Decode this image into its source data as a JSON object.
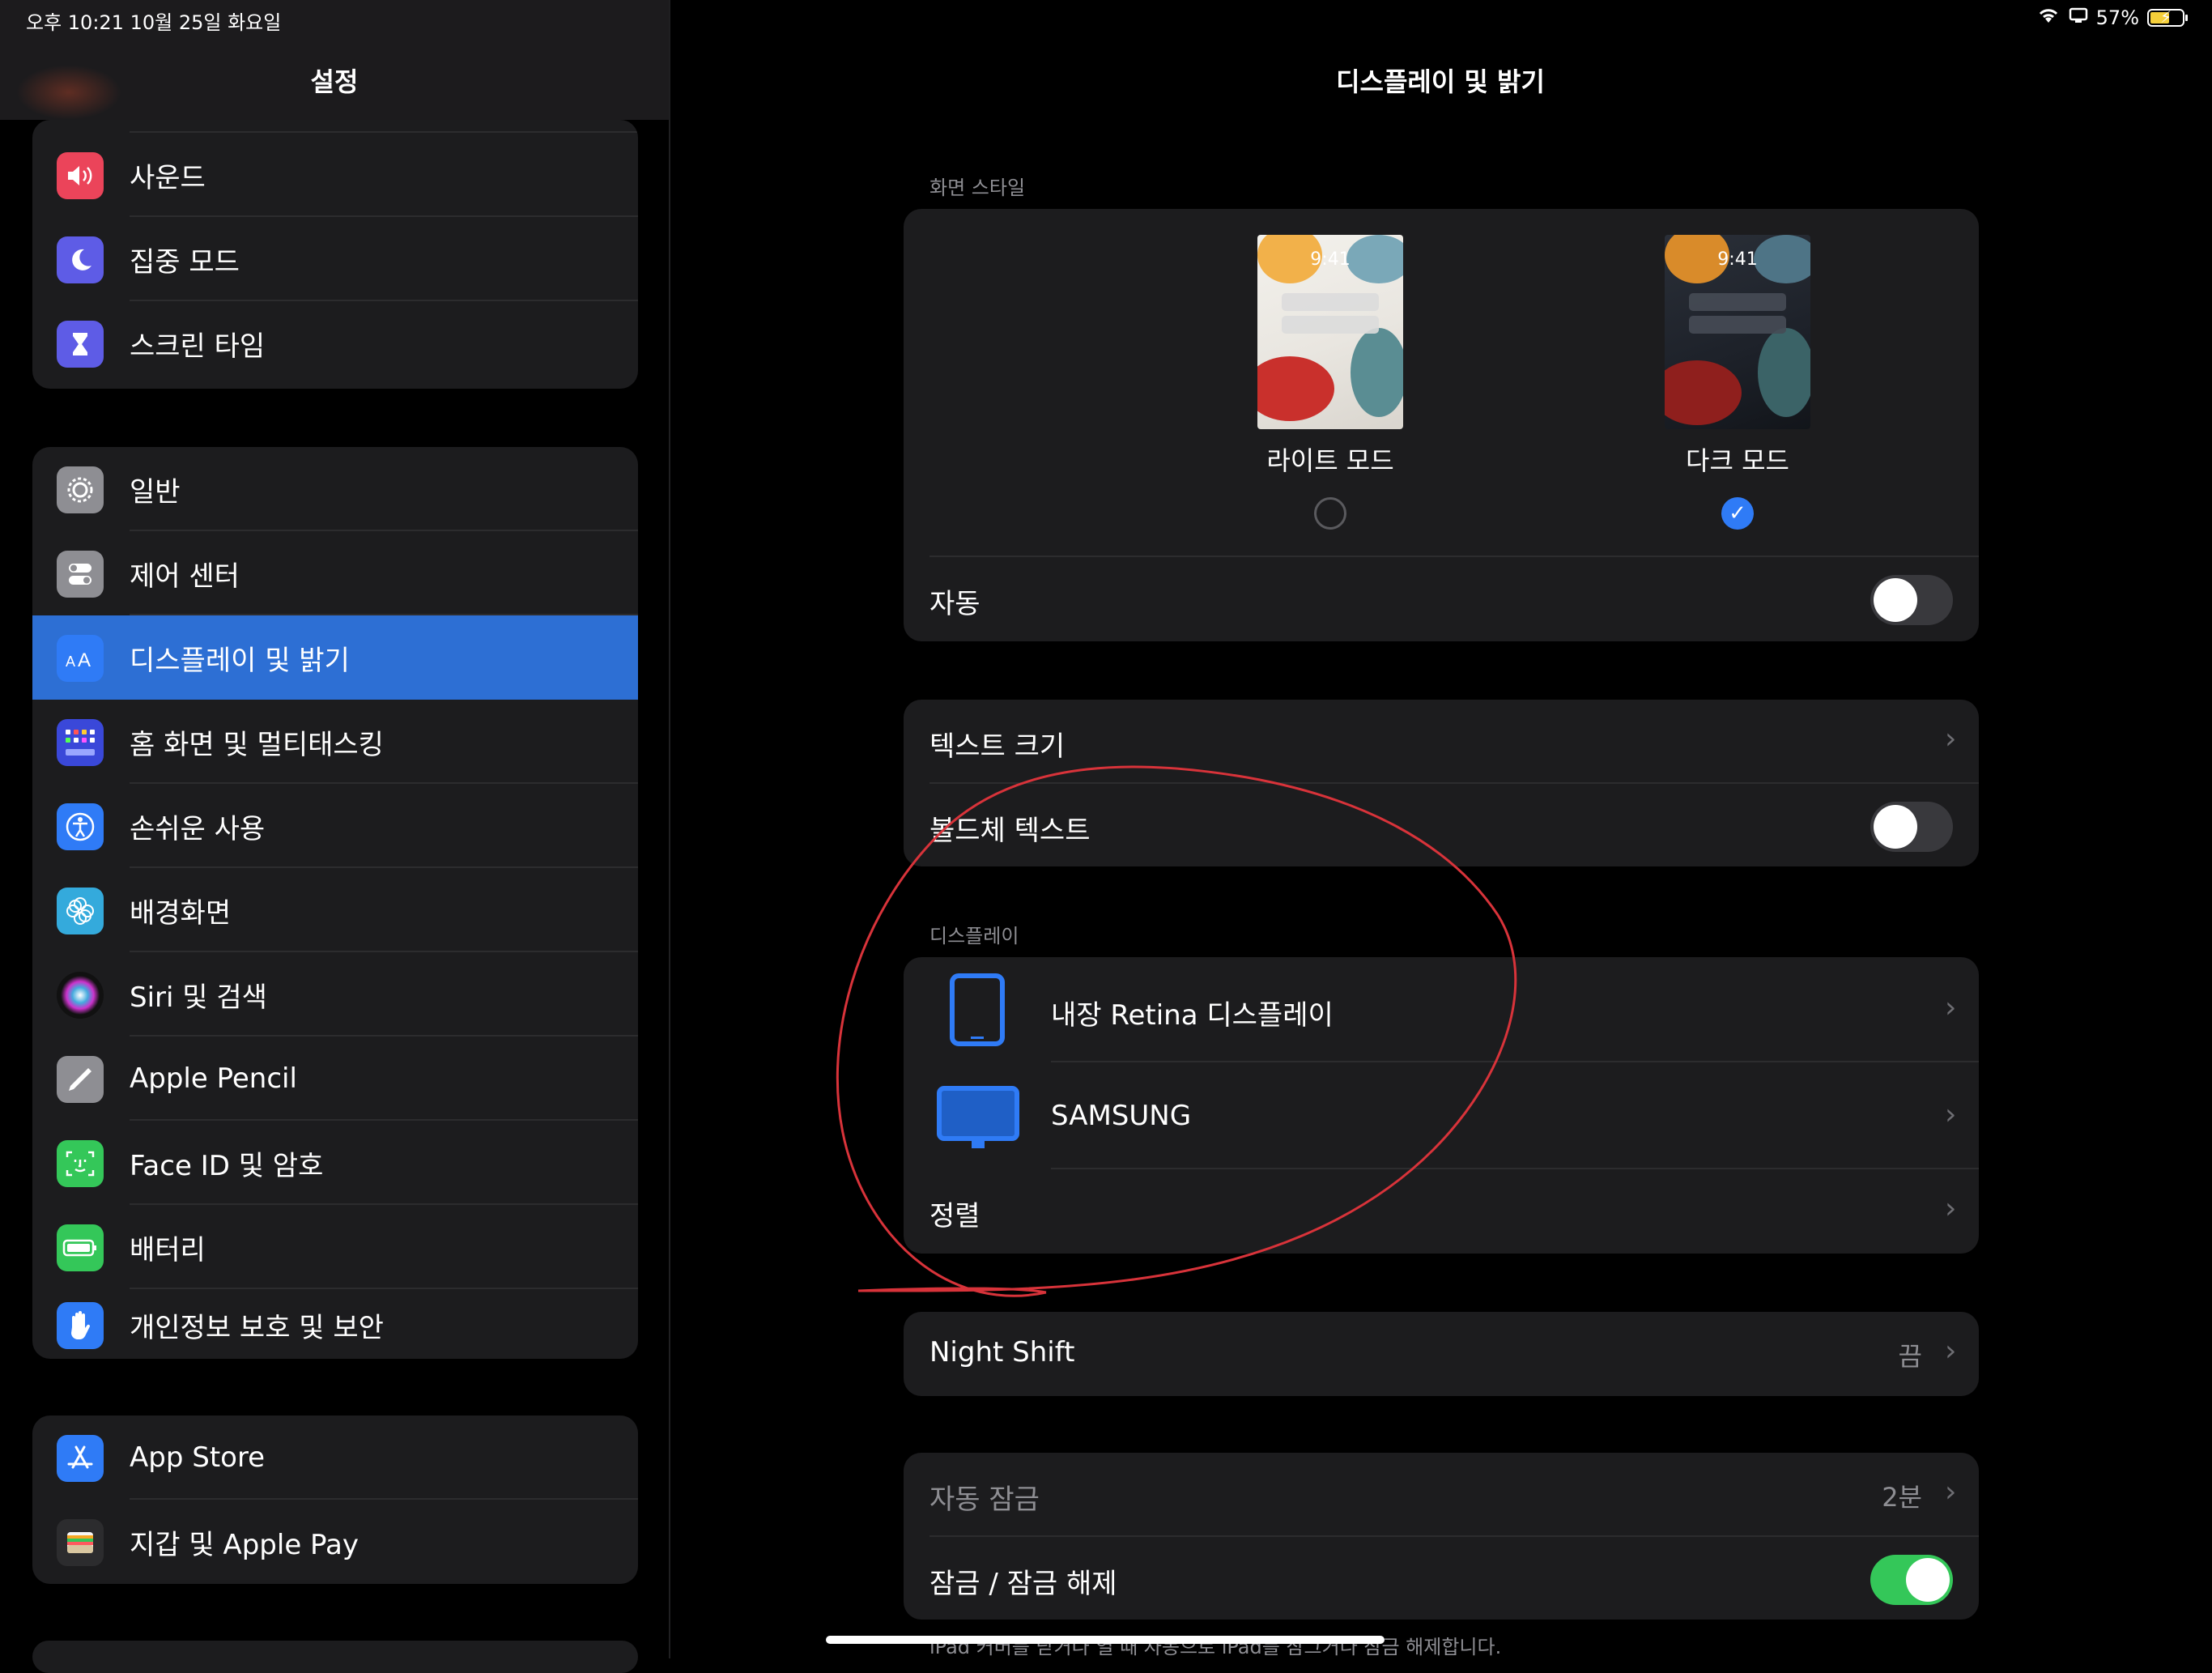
{
  "status_bar": {
    "time_date": "오후 10:21   10월 25일 화요일",
    "battery_percent": "57%",
    "icons": [
      "wifi-icon",
      "screen-mirroring-icon",
      "battery-charging-icon"
    ]
  },
  "sidebar": {
    "title": "설정",
    "groups": [
      {
        "items": [
          {
            "label": "사운드",
            "icon": "speaker-icon",
            "color": "#eb445a"
          },
          {
            "label": "집중 모드",
            "icon": "moon-icon",
            "color": "#5e5ce6"
          },
          {
            "label": "스크린 타임",
            "icon": "hourglass-icon",
            "color": "#5e5ce6"
          }
        ]
      },
      {
        "items": [
          {
            "label": "일반",
            "icon": "gear-icon",
            "color": "#8e8e93"
          },
          {
            "label": "제어 센터",
            "icon": "toggles-icon",
            "color": "#8e8e93"
          },
          {
            "label": "디스플레이 및 밝기",
            "icon": "text-size-icon",
            "color": "#2f7bf6",
            "selected": true
          },
          {
            "label": "홈 화면 및 멀티태스킹",
            "icon": "grid-icon",
            "color": "#3a48d9"
          },
          {
            "label": "손쉬운 사용",
            "icon": "accessibility-icon",
            "color": "#2f7bf6"
          },
          {
            "label": "배경화면",
            "icon": "flower-icon",
            "color": "#34aadc"
          },
          {
            "label": "Siri 및 검색",
            "icon": "siri-icon",
            "color": "#222"
          },
          {
            "label": "Apple Pencil",
            "icon": "pencil-icon",
            "color": "#8e8e93"
          },
          {
            "label": "Face ID 및 암호",
            "icon": "face-id-icon",
            "color": "#34c759"
          },
          {
            "label": "배터리",
            "icon": "battery-icon",
            "color": "#34c759"
          },
          {
            "label": "개인정보 보호 및 보안",
            "icon": "hand-icon",
            "color": "#2f7bf6"
          }
        ]
      },
      {
        "items": [
          {
            "label": "App Store",
            "icon": "app-store-icon",
            "color": "#2f7bf6"
          },
          {
            "label": "지갑 및 Apple Pay",
            "icon": "wallet-icon",
            "color": "#2c2c2e"
          }
        ]
      }
    ]
  },
  "main": {
    "title": "디스플레이 및 밝기",
    "appearance": {
      "section_label": "화면 스타일",
      "light": {
        "label": "라이트 모드",
        "time": "9:41",
        "selected": false
      },
      "dark": {
        "label": "다크 모드",
        "time": "9:41",
        "selected": true
      },
      "auto": {
        "label": "자동",
        "on": false
      }
    },
    "text": {
      "text_size": {
        "label": "텍스트 크기"
      },
      "bold_text": {
        "label": "볼드체 텍스트",
        "on": false
      }
    },
    "display": {
      "section_label": "디스플레이",
      "items": [
        {
          "label": "내장 Retina 디스플레이",
          "icon": "ipad-icon"
        },
        {
          "label": "SAMSUNG",
          "icon": "monitor-icon"
        }
      ],
      "arrange": {
        "label": "정렬"
      }
    },
    "night_shift": {
      "label": "Night Shift",
      "value": "끔"
    },
    "lock": {
      "auto_lock": {
        "label": "자동 잠금",
        "value": "2분"
      },
      "lock_unlock": {
        "label": "잠금 / 잠금 해제",
        "on": true
      },
      "footer": "iPad 커버를 닫거나 열 때 자동으로 iPad를 잠그거나 잠금 해제합니다."
    }
  }
}
